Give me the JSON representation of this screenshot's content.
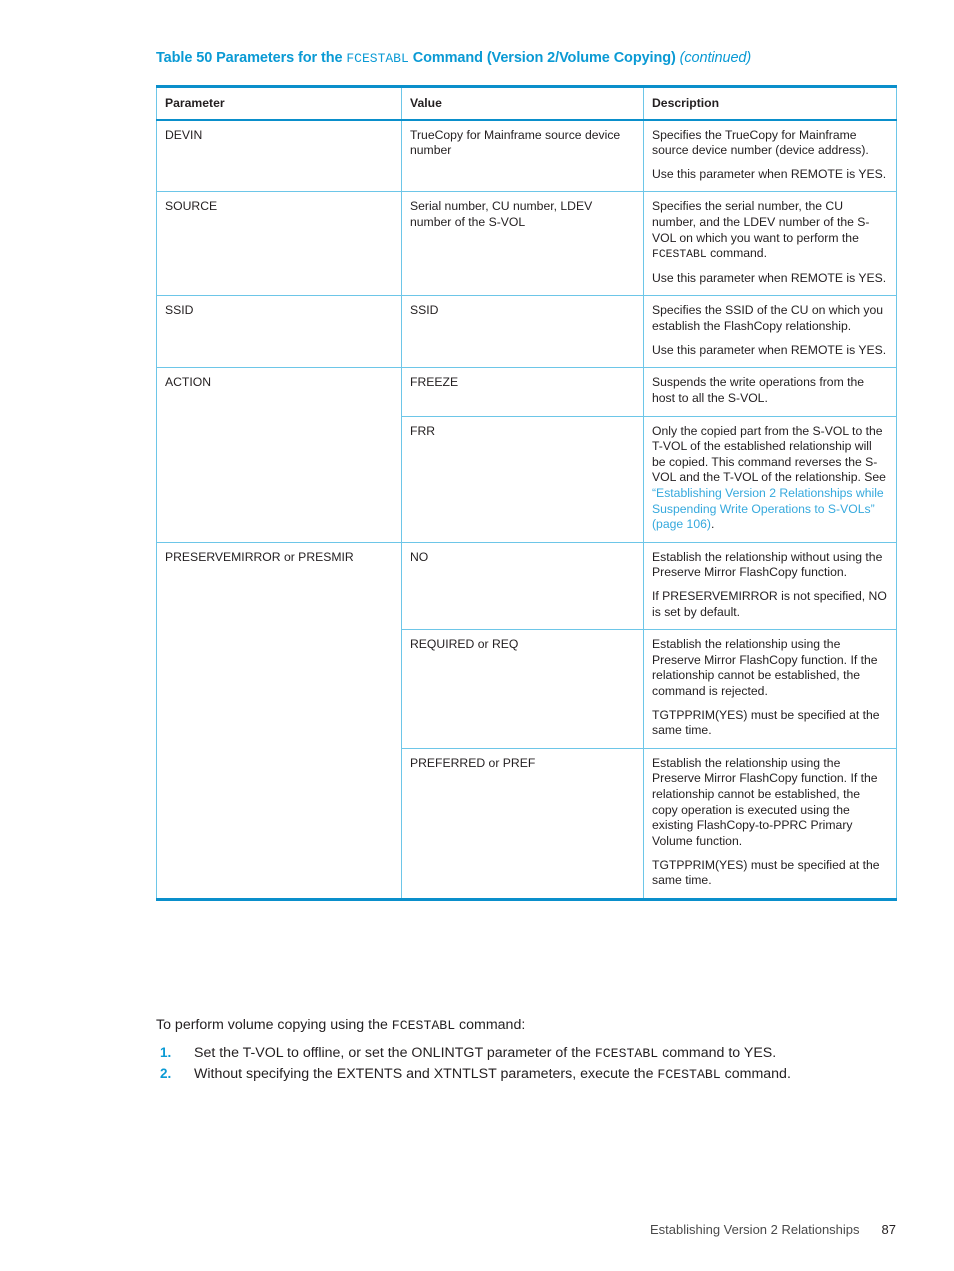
{
  "document": {
    "title_prefix": "Table 50 Parameters for the ",
    "title_mono": "FCESTABL",
    "title_suffix": " Command (Version 2/Volume Copying) ",
    "title_continued": "(continued)",
    "accent_color": "#0a9ad4",
    "border_color": "#6dc6e8",
    "link_color": "#36a9dd"
  },
  "table": {
    "headers": {
      "parameter": "Parameter",
      "value": "Value",
      "description": "Description"
    },
    "rows": [
      {
        "parameter": "DEVIN",
        "values": [
          {
            "value": "TrueCopy for Mainframe source device number",
            "description_p1": "Specifies the TrueCopy for Mainframe source device number (device address).",
            "description_p2": "Use this parameter when REMOTE is YES."
          }
        ]
      },
      {
        "parameter": "SOURCE",
        "values": [
          {
            "value": "Serial number, CU number, LDEV number of the S-VOL",
            "description_p1_a": "Specifies the serial number, the CU number, and the LDEV number of the S-VOL on which you want to perform the ",
            "description_p1_mono": "FCESTABL",
            "description_p1_b": " command.",
            "description_p2": "Use this parameter when REMOTE is YES."
          }
        ]
      },
      {
        "parameter": "SSID",
        "values": [
          {
            "value": "SSID",
            "description_p1": "Specifies the SSID of the CU on which you establish the FlashCopy relationship.",
            "description_p2": "Use this parameter when REMOTE is YES."
          }
        ]
      },
      {
        "parameter": "ACTION",
        "values": [
          {
            "value": "FREEZE",
            "description_p1": "Suspends the write operations from the host to all the S-VOL."
          },
          {
            "value": "FRR",
            "description_p1_a": "Only the copied part from the S-VOL to the T-VOL of the established relationship will be copied. This command reverses the S-VOL and the T-VOL of the relationship. See ",
            "description_p1_link": "“Establishing Version 2 Relationships while Suspending Write Operations to S-VOLs” (page 106)",
            "description_p1_b": "."
          }
        ]
      },
      {
        "parameter": "PRESERVEMIRROR or PRESMIR",
        "values": [
          {
            "value": "NO",
            "description_p1": "Establish the relationship without using the Preserve Mirror FlashCopy function.",
            "description_p2": "If PRESERVEMIRROR is not specified, NO is set by default."
          },
          {
            "value": "REQUIRED or REQ",
            "description_p1": "Establish the relationship using the Preserve Mirror FlashCopy function. If the relationship cannot be established, the command is rejected.",
            "description_p2": "TGTPPRIM(YES) must be specified at the same time."
          },
          {
            "value": "PREFERRED or PREF",
            "description_p1": "Establish the relationship using the Preserve Mirror FlashCopy function. If the relationship cannot be established, the copy operation is executed using the existing FlashCopy-to-PPRC Primary Volume function.",
            "description_p2": "TGTPPRIM(YES) must be specified at the same time."
          }
        ]
      }
    ]
  },
  "body": {
    "lead_a": "To perform volume copying using the ",
    "lead_mono": "FCESTABL",
    "lead_b": " command:",
    "steps": [
      {
        "num": "1.",
        "text_a": "Set the T-VOL to offline, or set the ONLINTGT parameter of the ",
        "mono": "FCESTABL",
        "text_b": " command to YES."
      },
      {
        "num": "2.",
        "text_a": "Without specifying the EXTENTS and XTNTLST parameters, execute the ",
        "mono": "FCESTABL",
        "text_b": " command."
      }
    ]
  },
  "footer": {
    "chapter": "Establishing Version 2 Relationships",
    "page": "87"
  }
}
